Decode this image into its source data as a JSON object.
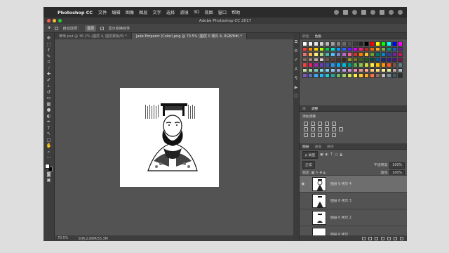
{
  "menubar": {
    "app_name": "Photoshop CC",
    "menus": [
      "文件",
      "编辑",
      "图像",
      "图层",
      "文字",
      "选择",
      "滤镜",
      "3D",
      "视图",
      "窗口",
      "帮助"
    ]
  },
  "window": {
    "title": "Adobe Photoshop CC 2017"
  },
  "options": {
    "auto_select": "自动选择：",
    "target": "图层",
    "show_transform": "显示变换控件"
  },
  "tabs": [
    {
      "label": "黄帝.psd @ 36.2% (图层 4, 图层蒙版/8) *",
      "active": false
    },
    {
      "label": "Jade Emperor (Color).png @ 70.5% (图层 0 拷贝 4, RGB/8#) *",
      "active": true
    }
  ],
  "status": {
    "zoom": "70.5%",
    "doc_size": "文档:2.86M/55.3M"
  },
  "panels": {
    "swatch_tabs": [
      "颜色",
      "色板"
    ],
    "adjust_tabs": [
      "库",
      "调整"
    ],
    "adjust_label": "添加调整",
    "layer_tabs": [
      "图层",
      "通道",
      "路径"
    ],
    "filter_kind": "ρ 类型",
    "blend_mode": "正常",
    "opacity_label": "不透明度:",
    "opacity": "100%",
    "lock_label": "锁定:",
    "fill_label": "填充:",
    "fill": "100%",
    "layers": [
      {
        "name": "图层 0 拷贝 4",
        "selected": true
      },
      {
        "name": "图层 0 拷贝 3",
        "selected": false
      },
      {
        "name": "图层 0 拷贝 2",
        "selected": false
      },
      {
        "name": "图层 0 拷贝",
        "selected": false
      }
    ]
  },
  "colors": {
    "swatches": [
      "#ffffff",
      "#f2f2f2",
      "#e6e6e6",
      "#d0d0d0",
      "#b8b8b8",
      "#9e9e9e",
      "#858585",
      "#6b6b6b",
      "#525252",
      "#3a3a3a",
      "#242424",
      "#000000",
      "#ff0000",
      "#ffff00",
      "#00ff00",
      "#00ffff",
      "#0000ff",
      "#ff00ff",
      "#ff3b3b",
      "#ff8a00",
      "#ffd300",
      "#b3ff00",
      "#00c853",
      "#00e5d1",
      "#00a2ff",
      "#2962ff",
      "#651fff",
      "#d500f9",
      "#ff1e7a",
      "#c62828",
      "#ef6c00",
      "#f9a825",
      "#7cb342",
      "#009688",
      "#1565c0",
      "#6a1b9a",
      "#e57373",
      "#ffb74d",
      "#fff176",
      "#aed581",
      "#4db6ac",
      "#4fc3f7",
      "#7986cb",
      "#ba68c8",
      "#f06292",
      "#d32f2f",
      "#f57c00",
      "#fbc02d",
      "#689f38",
      "#00796b",
      "#0288d1",
      "#303f9f",
      "#7b1fa2",
      "#c2185b",
      "#8d6e63",
      "#a1887f",
      "#bcaaa4",
      "#d7ccc8",
      "#795548",
      "#5d4037",
      "#4e342e",
      "#3e2723",
      "#9e9d24",
      "#827717",
      "#33691e",
      "#1b5e20",
      "#004d40",
      "#01579b",
      "#1a237e",
      "#311b92",
      "#4a148c",
      "#880e4f",
      "#f44336",
      "#e91e63",
      "#9c27b0",
      "#673ab7",
      "#3f51b5",
      "#2196f3",
      "#03a9f4",
      "#00bcd4",
      "#009688",
      "#4caf50",
      "#8bc34a",
      "#cddc39",
      "#ffeb3b",
      "#ffc107",
      "#ff9800",
      "#ff5722",
      "#795548",
      "#607d8b",
      "#c5e1a5",
      "#a5d6a7",
      "#80cbc4",
      "#80deea",
      "#81d4fa",
      "#90caf9",
      "#9fa8da",
      "#b39ddb",
      "#ce93d8",
      "#f48fb1",
      "#ef9a9a",
      "#ffab91",
      "#ffcc80",
      "#ffe082",
      "#fff59d",
      "#e6ee9c",
      "#bcaaa4",
      "#b0bec5",
      "#7e57c2",
      "#5c6bc0",
      "#42a5f5",
      "#29b6f6",
      "#26c6da",
      "#26a69a",
      "#66bb6a",
      "#9ccc65",
      "#d4e157",
      "#ffee58",
      "#ffca28",
      "#ffa726",
      "#ff7043",
      "#8d6e63",
      "#bdbdbd",
      "#78909c",
      "#455a64",
      "#263238"
    ]
  }
}
